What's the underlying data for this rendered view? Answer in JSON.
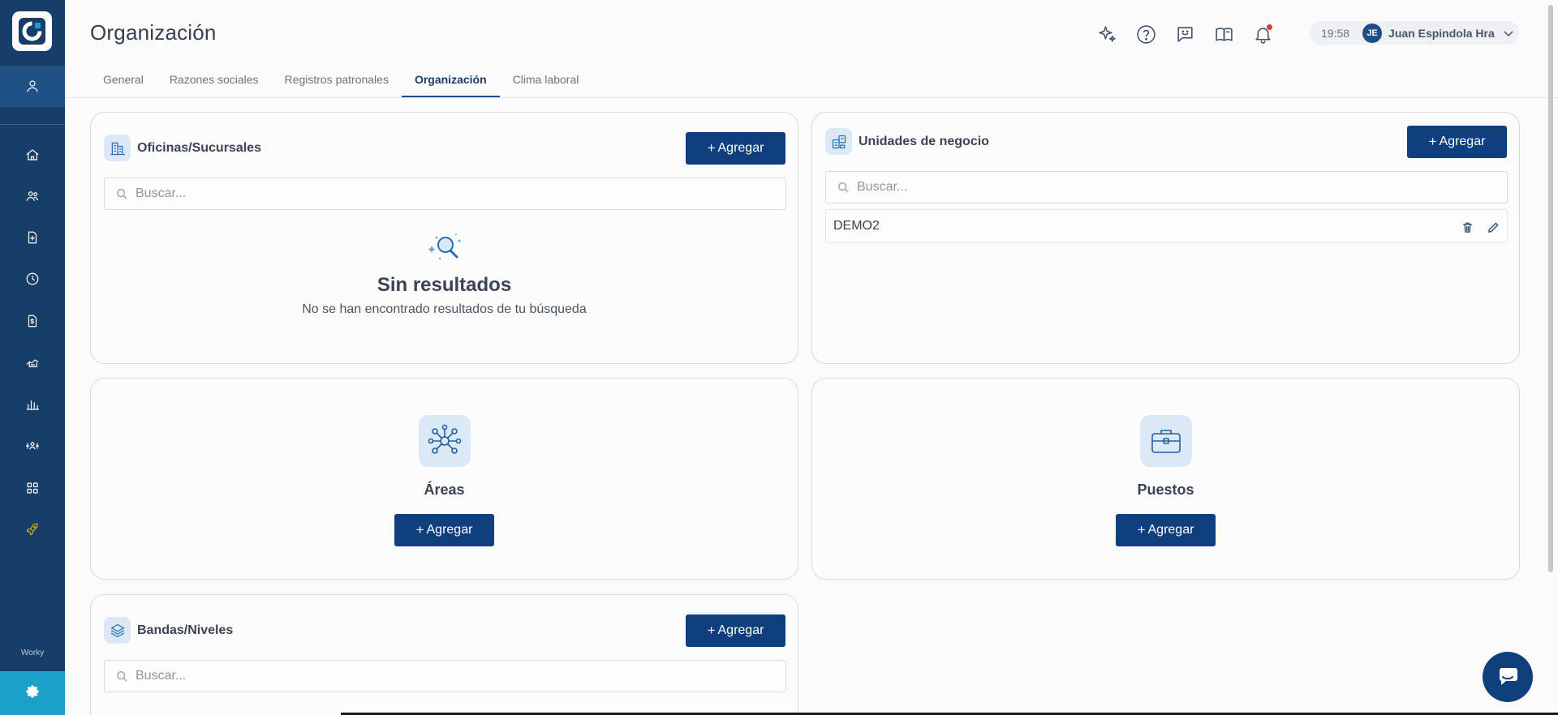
{
  "app": {
    "brand": "Worky"
  },
  "header": {
    "title": "Organización",
    "time": "19:58",
    "user_initials": "JE",
    "user_name": "Juan Espindola Hra"
  },
  "tabs": [
    {
      "label": "General"
    },
    {
      "label": "Razones sociales"
    },
    {
      "label": "Registros patronales"
    },
    {
      "label": "Organización",
      "active": true
    },
    {
      "label": "Clima laboral"
    }
  ],
  "offices": {
    "title": "Oficinas/Sucursales",
    "add_label": "Agregar",
    "search_placeholder": "Buscar...",
    "empty_title": "Sin resultados",
    "empty_subtitle": "No se han encontrado resultados de tu búsqueda"
  },
  "business_units": {
    "title": "Unidades de negocio",
    "add_label": "Agregar",
    "search_placeholder": "Buscar...",
    "items": [
      {
        "name": "DEMO2"
      }
    ]
  },
  "areas": {
    "title": "Áreas",
    "add_label": "Agregar"
  },
  "positions": {
    "title": "Puestos",
    "add_label": "Agregar"
  },
  "bands": {
    "title": "Bandas/Niveles",
    "add_label": "Agregar",
    "search_placeholder": "Buscar..."
  },
  "icons": {
    "sidebar": [
      "user-icon",
      "home-icon",
      "users-icon",
      "document-add-icon",
      "clock-icon",
      "payroll-icon",
      "handshake-icon",
      "bar-chart-icon",
      "team-icon",
      "apps-grid-icon",
      "rocket-icon",
      "gear-icon"
    ],
    "header": [
      "sparkles-icon",
      "help-icon",
      "feedback-icon",
      "book-icon",
      "bell-icon"
    ]
  },
  "colors": {
    "sidebar": "#163e68",
    "primary_button": "#0f3f7d",
    "settings_active": "#1aa0c9",
    "notification": "#e53935",
    "rocket_accent": "#d9a520"
  }
}
